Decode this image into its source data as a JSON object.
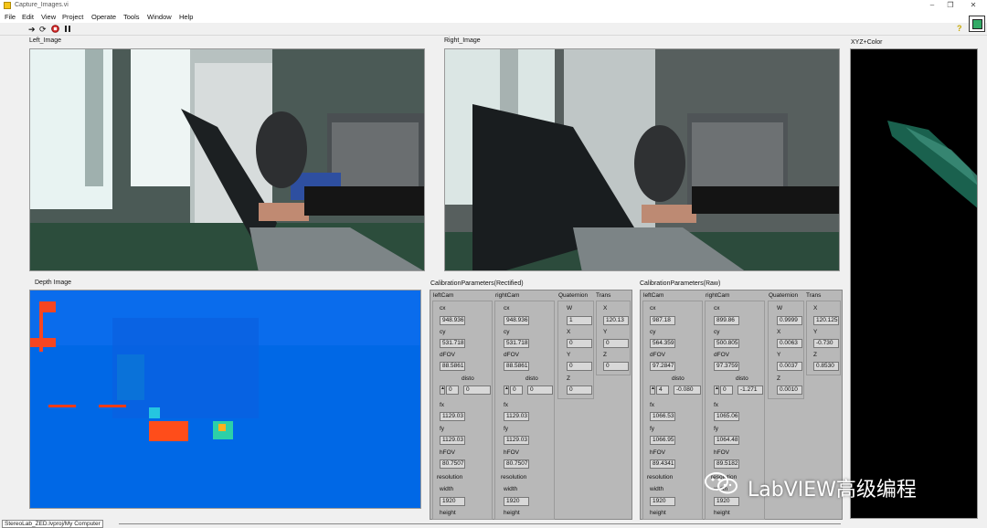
{
  "window": {
    "title": "Capture_Images.vi",
    "controls": [
      "–",
      "❐",
      "✕"
    ]
  },
  "menu": [
    "File",
    "Edit",
    "View",
    "Project",
    "Operate",
    "Tools",
    "Window",
    "Help"
  ],
  "toolbar": {
    "run_icon": "run-arrow-icon",
    "run_continuous_icon": "run-continuously-icon",
    "abort_icon": "abort-icon",
    "pause_icon": "pause-icon",
    "help_glyph": "?"
  },
  "labels": {
    "left_image": "Left_Image",
    "right_image": "Right_Image",
    "xyz_color": "XYZ+Color",
    "depth_image": "Depth Image",
    "cal_rectified": "CalibrationParameters(Rectified)",
    "cal_raw": "CalibrationParameters(Raw)"
  },
  "rectified": {
    "leftCam": {
      "title": "leftCam",
      "cx": "948.936",
      "cy": "531.718",
      "dFOV": "88.5861",
      "disto_label": "disto",
      "disto_idx": "0",
      "disto_val": "0",
      "fx": "1129.03",
      "fy": "1129.03",
      "hFOV": "80.7507",
      "resolution": "resolution",
      "width_label": "width",
      "width": "1920",
      "height_label": "height"
    },
    "rightCam": {
      "title": "rightCam",
      "cx": "948.936",
      "cy": "531.718",
      "dFOV": "88.5861",
      "disto_label": "disto",
      "disto_idx": "0",
      "disto_val": "0",
      "fx": "1129.03",
      "fy": "1129.03",
      "hFOV": "80.7507",
      "resolution": "resolution",
      "width_label": "width",
      "width": "1920",
      "height_label": "height"
    },
    "quaternion": {
      "title": "Quaternion",
      "W": "1",
      "X": "0",
      "Y": "0",
      "Z": "0"
    },
    "trans": {
      "title": "Trans",
      "X": "120.13",
      "Y": "0",
      "Z": "0"
    }
  },
  "raw": {
    "leftCam": {
      "title": "leftCam",
      "cx": "987.18",
      "cy": "564.359",
      "dFOV": "97.2847",
      "disto_label": "disto",
      "disto_idx": "4",
      "disto_val": "-0.080",
      "fx": "1066.53",
      "fy": "1066.95",
      "hFOV": "89.4341",
      "resolution": "resolution",
      "width_label": "width",
      "width": "1920",
      "height_label": "height"
    },
    "rightCam": {
      "title": "rightCam",
      "cx": "899.86",
      "cy": "500.805",
      "dFOV": "97.3759",
      "disto_label": "disto",
      "disto_idx": "0",
      "disto_val": "-1.271",
      "fx": "1065.06",
      "fy": "1064.48",
      "hFOV": "89.5182",
      "resolution": "resolution",
      "width_label": "width",
      "width": "1920",
      "height_label": "height"
    },
    "quaternion": {
      "title": "Quaternion",
      "W": "0.9999",
      "X": "0.0063",
      "Y": "0.0037",
      "Z": "0.0010"
    },
    "trans": {
      "title": "Trans",
      "X": "120.125",
      "Y": "-0.730",
      "Z": "0.8530"
    }
  },
  "status": {
    "path": "StereoLab_ZED.lvproj/My Computer"
  },
  "watermark": {
    "text": "LabVIEW高级编程",
    "icon": "wechat-icon"
  }
}
